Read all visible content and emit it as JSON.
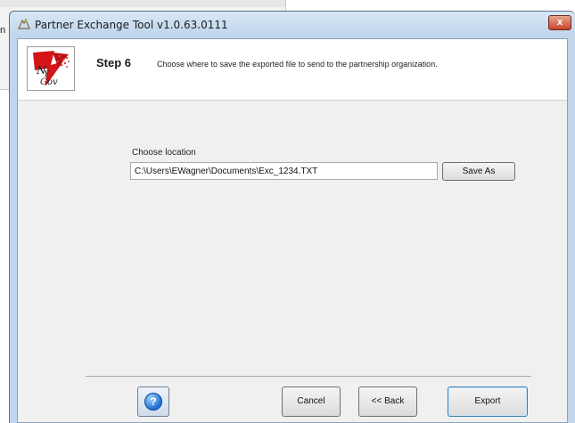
{
  "background_window": {
    "fragment_text": "n"
  },
  "window": {
    "title": "Partner Exchange Tool v1.0.63.0111",
    "close_label": "x"
  },
  "header": {
    "step": "Step 6",
    "description": "Choose where to save the exported file to send to the partnership organization."
  },
  "form": {
    "choose_location_label": "Choose location",
    "path_value": "C:\\Users\\EWagner\\Documents\\Exc_1234.TXT",
    "save_as_label": "Save As"
  },
  "footer": {
    "help_label": "?",
    "cancel_label": "Cancel",
    "back_label": "<< Back",
    "export_label": "Export"
  },
  "colors": {
    "title_bar": "#bed5ec",
    "close_button": "#c8452b",
    "client_background": "#f0f0f0",
    "export_border": "#3c7fb1"
  },
  "icons": {
    "title": "app-icon",
    "logo": "nygov-logo",
    "help": "help-icon"
  }
}
